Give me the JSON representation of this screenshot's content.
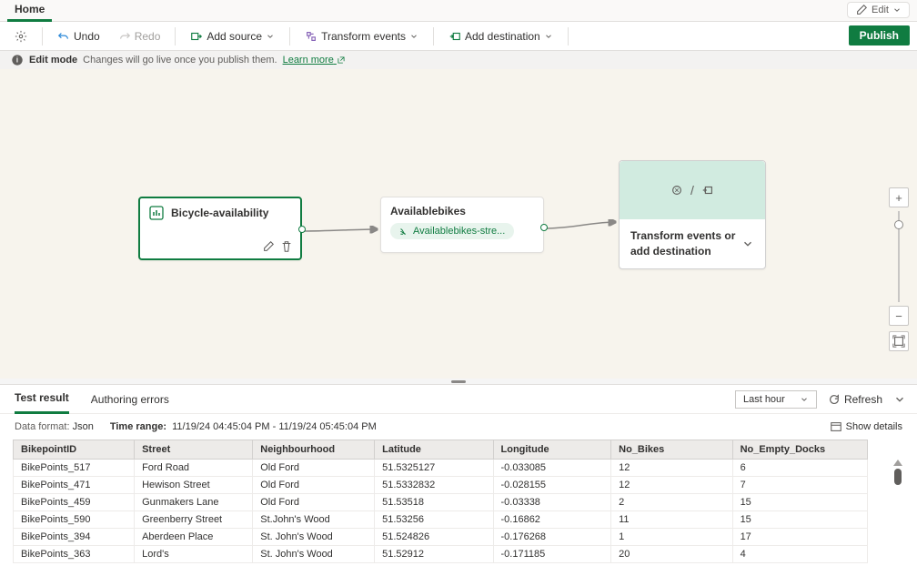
{
  "header": {
    "tab": "Home",
    "edit_pill": "Edit"
  },
  "toolbar": {
    "undo": "Undo",
    "redo": "Redo",
    "add_source": "Add source",
    "transform_events": "Transform events",
    "add_destination": "Add destination",
    "publish": "Publish"
  },
  "info": {
    "mode": "Edit mode",
    "msg": "Changes will go live once you publish them.",
    "learn": "Learn more"
  },
  "nodes": {
    "source": {
      "title": "Bicycle-availability"
    },
    "op": {
      "title": "Availablebikes",
      "chip": "Availablebikes-stre..."
    },
    "dest": {
      "label": "Transform events or add destination"
    }
  },
  "panel": {
    "tab_result": "Test result",
    "tab_errors": "Authoring errors",
    "time_filter": "Last hour",
    "refresh": "Refresh",
    "format_k": "Data format:",
    "format_v": "Json",
    "range_k": "Time range:",
    "range_v": "11/19/24 04:45:04 PM - 11/19/24 05:45:04 PM",
    "show_details": "Show details"
  },
  "table": {
    "headers": [
      "BikepointID",
      "Street",
      "Neighbourhood",
      "Latitude",
      "Longitude",
      "No_Bikes",
      "No_Empty_Docks"
    ],
    "rows": [
      [
        "BikePoints_517",
        "Ford Road",
        "Old Ford",
        "51.5325127",
        "-0.033085",
        "12",
        "6"
      ],
      [
        "BikePoints_471",
        "Hewison Street",
        "Old Ford",
        "51.5332832",
        "-0.028155",
        "12",
        "7"
      ],
      [
        "BikePoints_459",
        "Gunmakers Lane",
        "Old Ford",
        "51.53518",
        "-0.03338",
        "2",
        "15"
      ],
      [
        "BikePoints_590",
        "Greenberry Street",
        "St.John's Wood",
        "51.53256",
        "-0.16862",
        "11",
        "15"
      ],
      [
        "BikePoints_394",
        "Aberdeen Place",
        "St. John's Wood",
        "51.524826",
        "-0.176268",
        "1",
        "17"
      ],
      [
        "BikePoints_363",
        "Lord's",
        "St. John's Wood",
        "51.52912",
        "-0.171185",
        "20",
        "4"
      ]
    ]
  }
}
